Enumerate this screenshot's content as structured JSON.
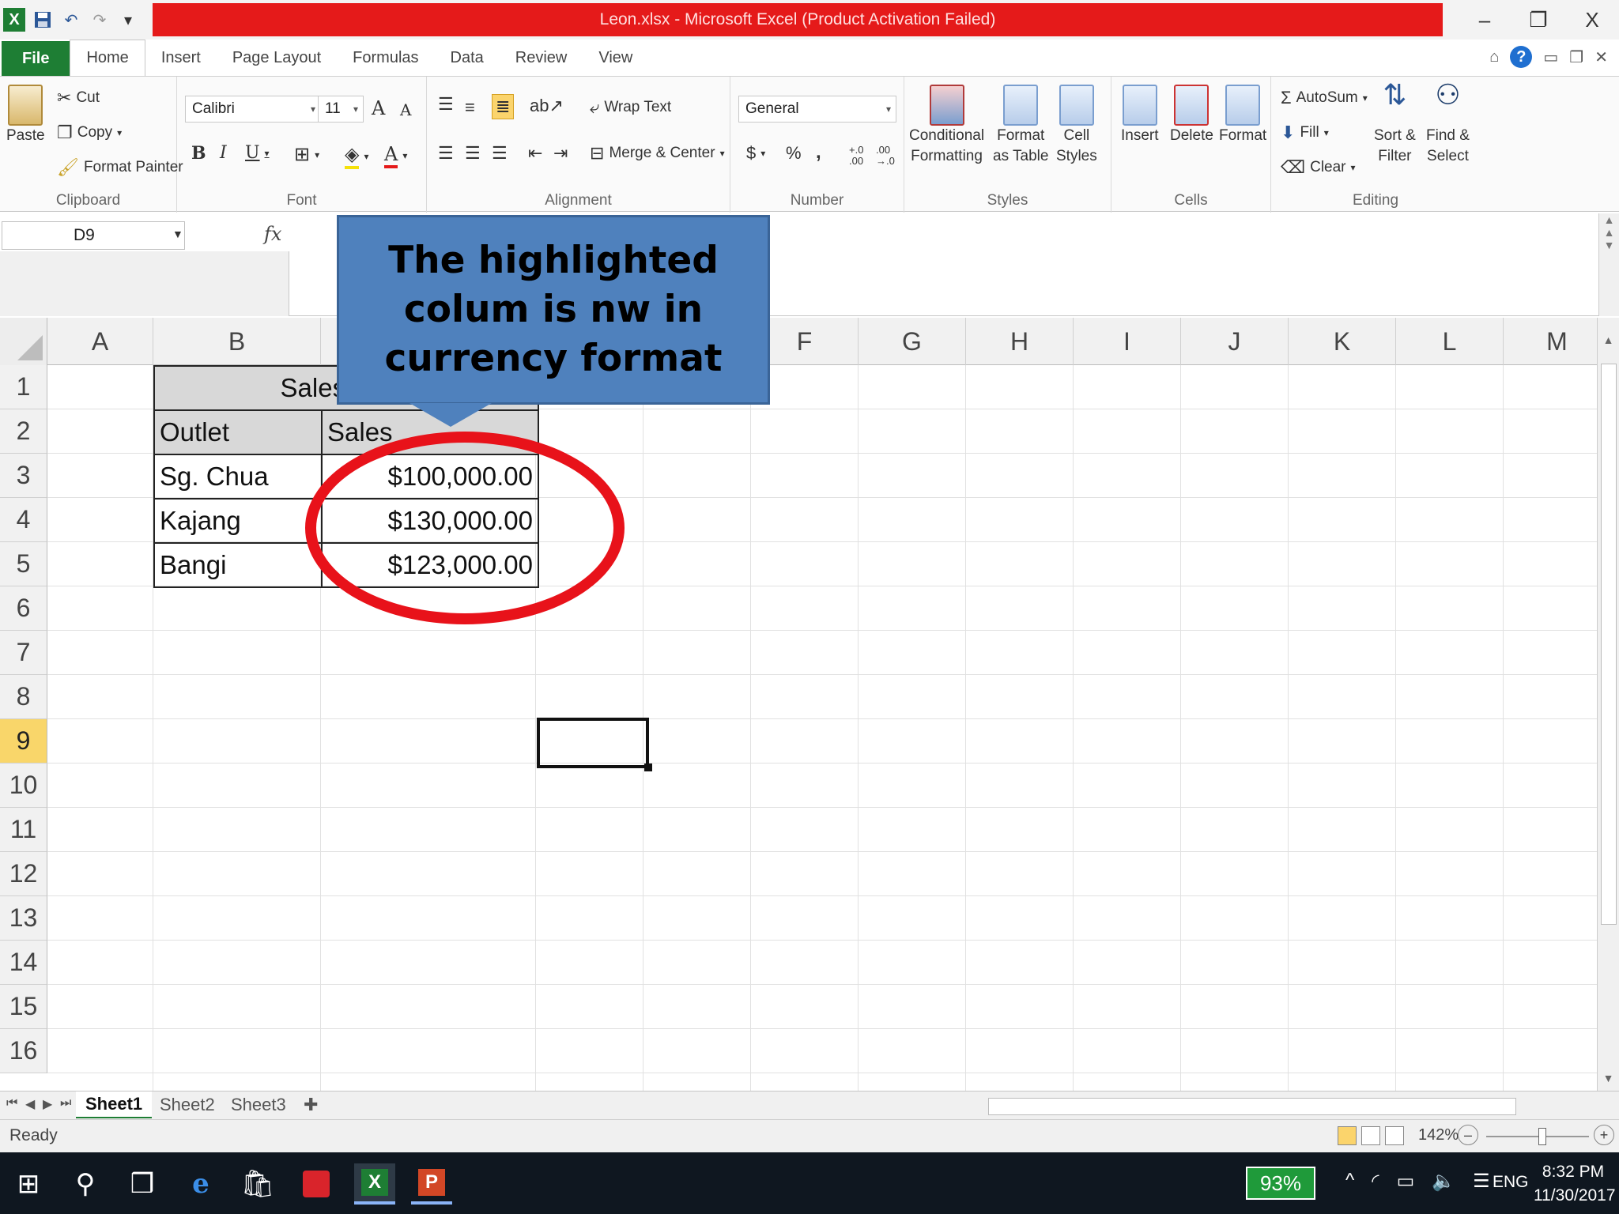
{
  "window": {
    "title": "Leon.xlsx - Microsoft Excel (Product Activation Failed)",
    "controls": [
      "–",
      "❐",
      "X"
    ]
  },
  "qat": {
    "excel_icon": "X",
    "save_icon": "💾",
    "undo_icon": "↶",
    "redo_icon": "↷",
    "customize_icon": "▾"
  },
  "tabs": [
    "File",
    "Home",
    "Insert",
    "Page Layout",
    "Formulas",
    "Data",
    "Review",
    "View"
  ],
  "help": {
    "question": "?"
  },
  "ribbon": {
    "clipboard": {
      "paste": "Paste",
      "cut": "Cut",
      "copy": "Copy",
      "format_painter": "Format Painter",
      "label": "Clipboard"
    },
    "font": {
      "name": "Calibri",
      "size": "11",
      "bold": "B",
      "italic": "I",
      "underline": "U",
      "label": "Font",
      "grow": "A",
      "shrink": "A",
      "font_color": "A"
    },
    "alignment": {
      "wrap_text": "Wrap Text",
      "merge_center": "Merge & Center",
      "label": "Alignment"
    },
    "number": {
      "format": "General",
      "currency": "$",
      "percent": "%",
      "comma": ",",
      "inc_dec": "+.0 .00",
      "dec_dec": ".00 →.0",
      "label": "Number"
    },
    "styles": {
      "conditional_1": "Conditional",
      "conditional_2": "Formatting",
      "format_table_1": "Format",
      "format_table_2": "as Table",
      "cell_styles_1": "Cell",
      "cell_styles_2": "Styles",
      "label": "Styles"
    },
    "cells": {
      "insert": "Insert",
      "delete": "Delete",
      "format": "Format",
      "label": "Cells"
    },
    "editing": {
      "autosum": "AutoSum",
      "fill": "Fill",
      "clear": "Clear",
      "sort_1": "Sort &",
      "sort_2": "Filter",
      "find_1": "Find &",
      "find_2": "Select",
      "label": "Editing"
    }
  },
  "formula_bar": {
    "name_box": "D9",
    "fx": "fx",
    "value": ""
  },
  "columns": [
    "A",
    "B",
    "C",
    "D",
    "E",
    "F",
    "G",
    "H",
    "I",
    "J",
    "K",
    "L",
    "M"
  ],
  "rows": [
    "1",
    "2",
    "3",
    "4",
    "5",
    "6",
    "7",
    "8",
    "9",
    "10",
    "11",
    "12",
    "13",
    "14",
    "15",
    "16"
  ],
  "selected_row": "9",
  "table": {
    "title": "Sales by Di",
    "headers": [
      "Outlet",
      "Sales"
    ],
    "rows": [
      {
        "outlet": "Sg. Chua",
        "sales": "$100,000.00"
      },
      {
        "outlet": "Kajang",
        "sales": "$130,000.00"
      },
      {
        "outlet": "Bangi",
        "sales": "$123,000.00"
      }
    ]
  },
  "annotation": {
    "line1": "The highlighted",
    "line2": "colum is nw in",
    "line3": "currency format",
    "circle_color": "#e8121a",
    "callout_color": "#4f81bd"
  },
  "sheets": [
    "Sheet1",
    "Sheet2",
    "Sheet3"
  ],
  "active_sheet": "Sheet1",
  "status": {
    "text": "Ready",
    "zoom": "142%",
    "zoom_out": "–",
    "zoom_in": "+"
  },
  "taskbar": {
    "battery": "93%",
    "lang": "ENG",
    "time": "8:32 PM",
    "date": "11/30/2017"
  },
  "colors": {
    "title_red": "#e51a1a",
    "file_tab_green": "#1e7e34",
    "selected_row_header": "#f9d66a"
  }
}
